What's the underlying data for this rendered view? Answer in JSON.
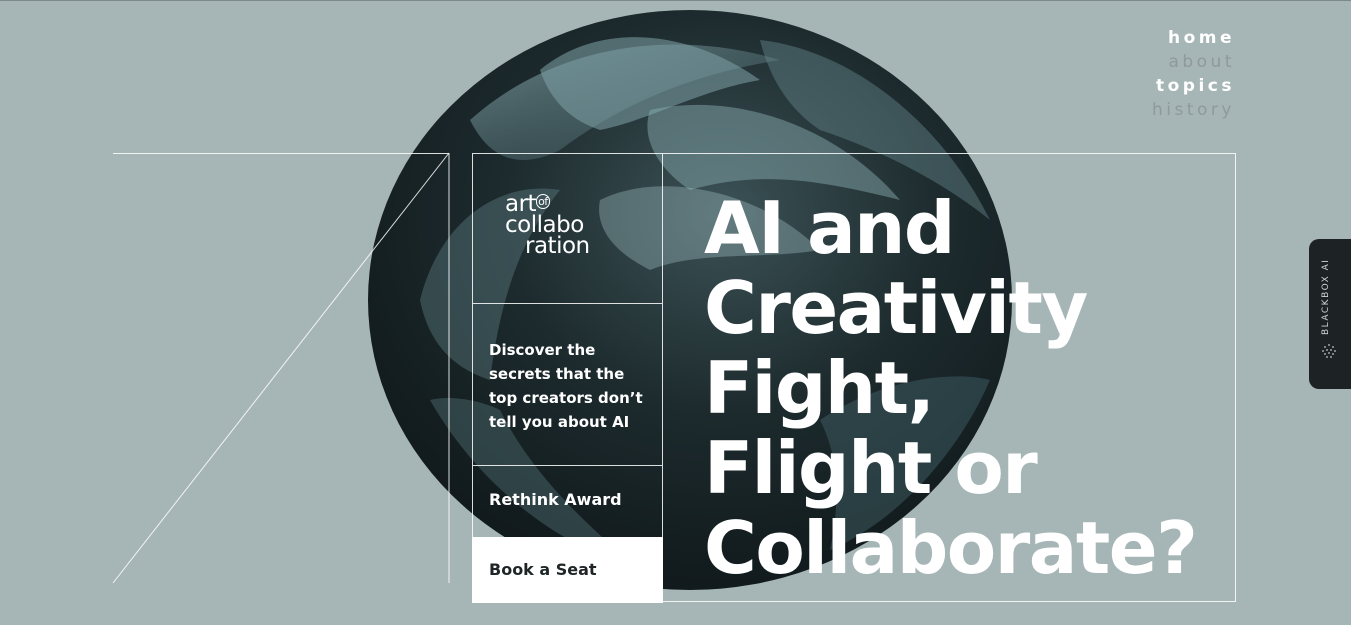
{
  "nav": {
    "items": [
      {
        "label": "home",
        "style": "light"
      },
      {
        "label": "about",
        "style": "dim"
      },
      {
        "label": "topics",
        "style": "light"
      },
      {
        "label": "history",
        "style": "dim"
      }
    ]
  },
  "logo": {
    "line1": "art",
    "of": "of",
    "line2": "collabo",
    "line3": "ration"
  },
  "intro": {
    "description": "Discover the secrets that the top creators don’t tell you about AI",
    "award_label": "Rethink Award",
    "book_label": "Book a Seat"
  },
  "headline": {
    "lines": [
      "AI and",
      "Creativity",
      "Fight,",
      "Flight or",
      "Collaborate?"
    ]
  },
  "side_tab": {
    "label": "BLACKBOX AI",
    "icon": "dots-grid-icon"
  },
  "colors": {
    "background": "#a6b5b5",
    "text": "#ffffff",
    "tab": "#1d2224",
    "dim_nav": "#8f9a9a"
  }
}
